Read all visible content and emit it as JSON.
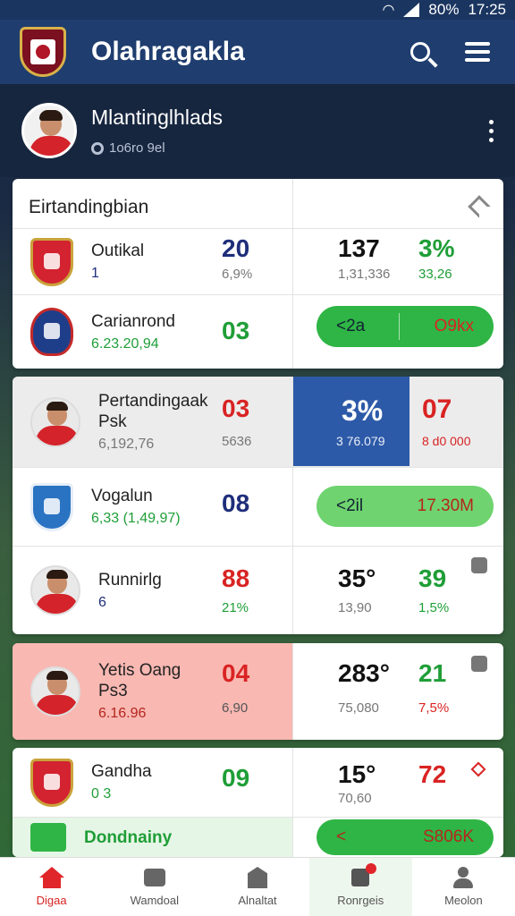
{
  "status_bar": {
    "battery": "80%",
    "time": "17:25"
  },
  "app": {
    "title": "Olahragakla"
  },
  "profile": {
    "name": "Mlantinglhlads",
    "subtitle": "1o6ro 9el"
  },
  "card1": {
    "header": "Eirtandingbian",
    "rows": [
      {
        "name": "Outikal",
        "sub": "1",
        "big": "20",
        "small": "6,9%",
        "c1": "137",
        "c1s": "1,31,336",
        "c2": "3%",
        "c2s": "33,26"
      },
      {
        "name": "Carianrond",
        "sub": "6.23.20,94",
        "big": "03",
        "pill_left": "<2a",
        "pill_right": "O9kx"
      }
    ]
  },
  "card2": {
    "rows": [
      {
        "name": "Pertandingaak\nPsk",
        "sub": "6,192,76",
        "big": "03",
        "small": "5636",
        "c1": "3%",
        "c1s": "3 76.079",
        "c2": "07",
        "c2s": "8 d0 000"
      },
      {
        "name": "Vogalun",
        "sub": "6,33 (1,49,97)",
        "big": "08",
        "pill_left": "<2il",
        "pill_right": "17.30M"
      },
      {
        "name": "Runnirlg",
        "sub": "6",
        "big": "88",
        "small": "21%",
        "c1": "35°",
        "c1s": "13,90",
        "c2": "39",
        "c2s": "1,5%"
      }
    ]
  },
  "card3": {
    "name": "Yetis Oang\nPs3",
    "sub": "6.16.96",
    "big": "04",
    "small": "6,90",
    "c1": "283°",
    "c1s": "75,080",
    "c2": "21",
    "c2s": "7,5%"
  },
  "card4": {
    "rows": [
      {
        "name": "Gandha",
        "sub": "0 3",
        "big": "09",
        "c1": "15°",
        "c1s": "70,60",
        "c2": "72"
      },
      {
        "name": "Dondnainy",
        "pill_left": "<",
        "pill_right": "S806K"
      }
    ]
  },
  "nav": [
    {
      "label": "Digaa"
    },
    {
      "label": "Wamdoal"
    },
    {
      "label": "Alnaltat"
    },
    {
      "label": "Ronrgeis"
    },
    {
      "label": "Meolon"
    }
  ]
}
